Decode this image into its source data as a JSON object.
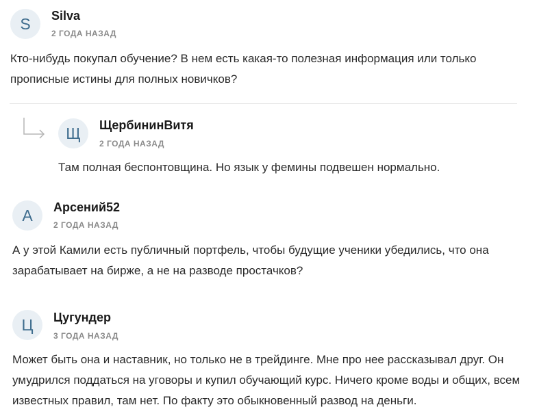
{
  "comments": [
    {
      "avatar_letter": "S",
      "author": "Silva",
      "date": "2 ГОДА НАЗАД",
      "text": "Кто-нибудь покупал обучение? В нем есть какая-то полезная информация или только прописные истины для полных новичков?"
    },
    {
      "avatar_letter": "Щ",
      "author": "ЩербининВитя",
      "date": "2 ГОДА НАЗАД",
      "text": "Там полная беспонтовщина. Но язык у фемины подвешен нормально.",
      "is_reply": true
    },
    {
      "avatar_letter": "А",
      "author": "Арсений52",
      "date": "2 ГОДА НАЗАД",
      "text": "А у этой Камили есть публичный портфель, чтобы будущие ученики убедились, что она зарабатывает на бирже, а не на разводе простачков?"
    },
    {
      "avatar_letter": "Ц",
      "author": "Цугундер",
      "date": "3 ГОДА НАЗАД",
      "text": "Может быть она и наставник, но только не в трейдинге. Мне про нее рассказывал друг. Он умудрился поддаться на уговоры и купил обучающий курс. Ничего кроме воды и общих, всем известных правил, там нет. По факту это обыкновенный развод на деньги."
    }
  ],
  "colors": {
    "avatar_bg": "#e9eff4",
    "avatar_letter": "#3f6d8e",
    "date": "#8a8a8a",
    "divider": "#e6e6e6"
  },
  "icons": {
    "reply": "reply-arrow-icon"
  }
}
